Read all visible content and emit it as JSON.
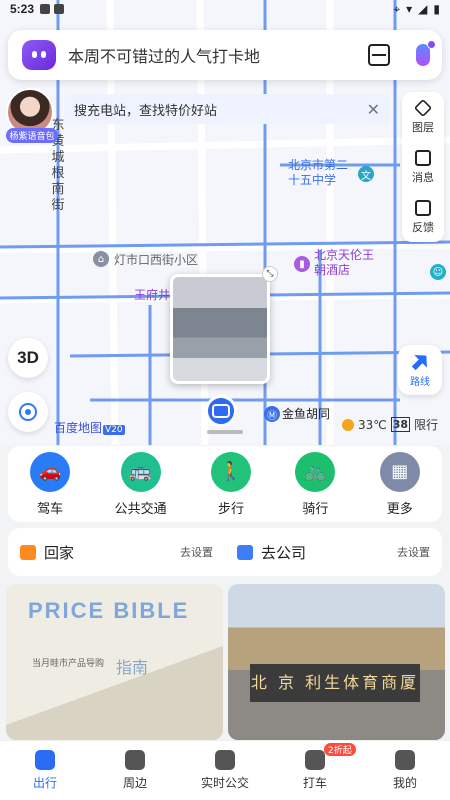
{
  "status": {
    "time": "5:23"
  },
  "search": {
    "placeholder": "本周不可错过的人气打卡地"
  },
  "avatar": {
    "label": "杨紫语音包"
  },
  "tip": {
    "text": "搜充电站，查找特价好站",
    "close": "✕"
  },
  "tools": [
    {
      "label": "图层",
      "icon": "layers-icon"
    },
    {
      "label": "消息",
      "icon": "message-icon"
    },
    {
      "label": "反馈",
      "icon": "feedback-icon"
    }
  ],
  "map": {
    "street": "东黄城根南街",
    "labels": {
      "school": "北京市第二十五中学",
      "hotel": "北京天伦王朝酒店",
      "residence": "灯市口西街小区",
      "wangfujing": "王府井",
      "hutong": "金鱼胡同"
    },
    "btn3d": "3D",
    "route": "路线",
    "weather": "33℃",
    "limit_numbers": "38",
    "limit_text": "限行",
    "logo": "百度地图",
    "logo_version": "V20"
  },
  "transport": [
    {
      "label": "驾车",
      "color": "#2a7cf6",
      "icon": "car-icon",
      "glyph": "🚗"
    },
    {
      "label": "公共交通",
      "color": "#1fbf8f",
      "icon": "bus-icon",
      "glyph": "🚌"
    },
    {
      "label": "步行",
      "color": "#22c27a",
      "icon": "walk-icon",
      "glyph": "🚶"
    },
    {
      "label": "骑行",
      "color": "#1bbf6d",
      "icon": "bike-icon",
      "glyph": "🚲"
    },
    {
      "label": "更多",
      "color": "#7f8aa8",
      "icon": "more-grid-icon",
      "glyph": "▦"
    }
  ],
  "shortcuts": [
    {
      "title": "回家",
      "action": "去设置",
      "color": "#ff8a1f"
    },
    {
      "title": "去公司",
      "action": "去设置",
      "color": "#3f7df7"
    }
  ],
  "cards": {
    "card1_price": "PRICE BIBLE",
    "card1_sub": "当月畦市产品导购",
    "card1_guide": "指南",
    "card2_sign": "北 京 利生体育商厦"
  },
  "nav": [
    {
      "label": "出行",
      "active": true
    },
    {
      "label": "周边"
    },
    {
      "label": "实时公交"
    },
    {
      "label": "打车",
      "badge": "2折起"
    },
    {
      "label": "我的"
    }
  ]
}
